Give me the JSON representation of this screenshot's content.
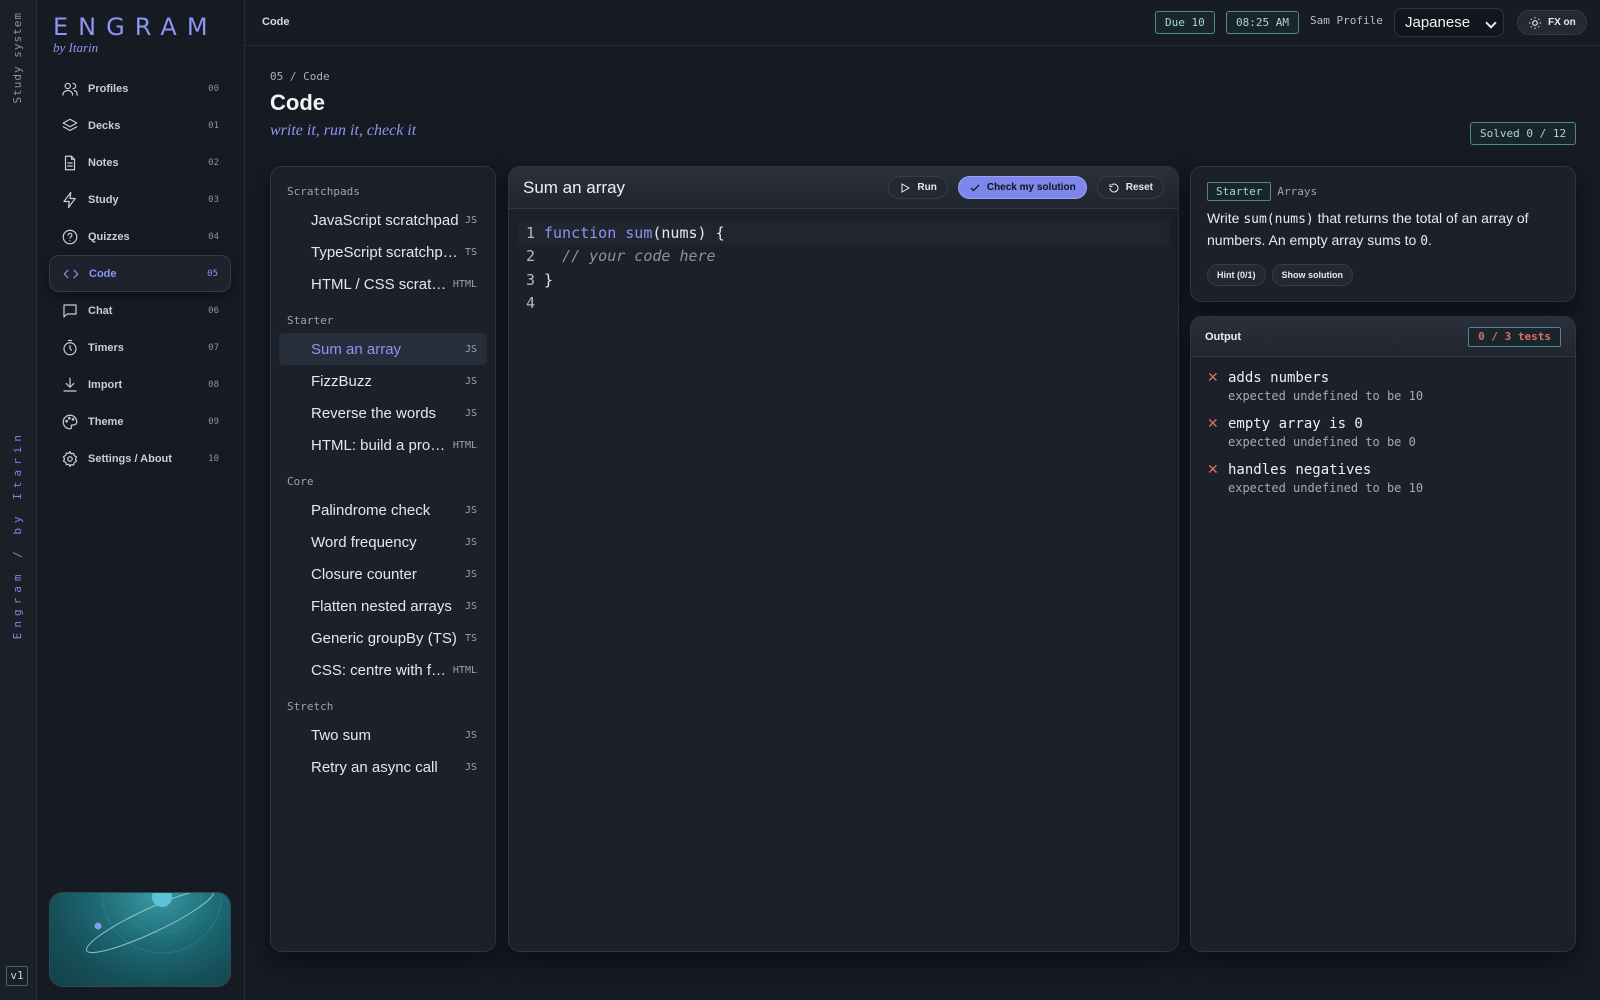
{
  "rail": {
    "top_label": "Study system",
    "bottom_label": "Engram / by Itarin",
    "version": "v1"
  },
  "brand": {
    "name": "ENGRAM",
    "byline": "by Itarin"
  },
  "nav": [
    {
      "label": "Profiles",
      "num": "00",
      "icon": "users-icon"
    },
    {
      "label": "Decks",
      "num": "01",
      "icon": "layers-icon"
    },
    {
      "label": "Notes",
      "num": "02",
      "icon": "file-icon"
    },
    {
      "label": "Study",
      "num": "03",
      "icon": "bolt-icon"
    },
    {
      "label": "Quizzes",
      "num": "04",
      "icon": "help-circle-icon"
    },
    {
      "label": "Code",
      "num": "05",
      "icon": "code-icon",
      "active": true
    },
    {
      "label": "Chat",
      "num": "06",
      "icon": "chat-icon"
    },
    {
      "label": "Timers",
      "num": "07",
      "icon": "timer-icon"
    },
    {
      "label": "Import",
      "num": "08",
      "icon": "download-icon"
    },
    {
      "label": "Theme",
      "num": "09",
      "icon": "palette-icon"
    },
    {
      "label": "Settings / About",
      "num": "10",
      "icon": "gear-icon"
    }
  ],
  "topbar": {
    "crumb": "Code",
    "due": "Due 10",
    "time": "08:25 AM",
    "profile": "Sam Profile",
    "language": "Japanese",
    "fx": "FX on"
  },
  "page": {
    "eyebrow": "05 / Code",
    "title": "Code",
    "subtitle": "write it, run it, check it",
    "solved": "Solved 0 / 12"
  },
  "exercises": {
    "groups": [
      {
        "name": "Scratchpads",
        "items": [
          {
            "name": "JavaScript scratchpad",
            "lang": "JS"
          },
          {
            "name": "TypeScript scratchpad",
            "lang": "TS"
          },
          {
            "name": "HTML / CSS scratchpad",
            "lang": "HTML"
          }
        ]
      },
      {
        "name": "Starter",
        "items": [
          {
            "name": "Sum an array",
            "lang": "JS",
            "active": true
          },
          {
            "name": "FizzBuzz",
            "lang": "JS"
          },
          {
            "name": "Reverse the words",
            "lang": "JS"
          },
          {
            "name": "HTML: build a profile card",
            "lang": "HTML"
          }
        ]
      },
      {
        "name": "Core",
        "items": [
          {
            "name": "Palindrome check",
            "lang": "JS"
          },
          {
            "name": "Word frequency",
            "lang": "JS"
          },
          {
            "name": "Closure counter",
            "lang": "JS"
          },
          {
            "name": "Flatten nested arrays",
            "lang": "JS"
          },
          {
            "name": "Generic groupBy (TS)",
            "lang": "TS"
          },
          {
            "name": "CSS: centre with flexbox",
            "lang": "HTML"
          }
        ]
      },
      {
        "name": "Stretch",
        "items": [
          {
            "name": "Two sum",
            "lang": "JS"
          },
          {
            "name": "Retry an async call",
            "lang": "JS"
          }
        ]
      }
    ]
  },
  "editor": {
    "title": "Sum an array",
    "run_label": "Run",
    "check_label": "Check my solution",
    "reset_label": "Reset",
    "lines": [
      {
        "no": "1",
        "kw": "function",
        "fn": "sum",
        "rest": "(nums) {"
      },
      {
        "no": "2",
        "comment": "  // your code here"
      },
      {
        "no": "3",
        "rest": "}"
      },
      {
        "no": "4",
        "rest": ""
      }
    ]
  },
  "task": {
    "tag_level": "Starter",
    "tag_topic": "Arrays",
    "desc_pre": "Write ",
    "desc_code": "sum(nums)",
    "desc_mid": " that returns the total of an array of numbers. An empty array sums to ",
    "desc_code2": "0",
    "desc_end": ".",
    "hint_label": "Hint (0/1)",
    "solution_label": "Show solution"
  },
  "output": {
    "title": "Output",
    "tests_badge": "0 / 3 tests",
    "tests": [
      {
        "name": "adds numbers",
        "message": "expected undefined to be 10"
      },
      {
        "name": "empty array is 0",
        "message": "expected undefined to be 0"
      },
      {
        "name": "handles negatives",
        "message": "expected undefined to be 10"
      }
    ]
  },
  "colors": {
    "accent": "#8d95f2",
    "fail": "#e06b6b",
    "teal": "#4f8796",
    "bg": "#161a22"
  }
}
